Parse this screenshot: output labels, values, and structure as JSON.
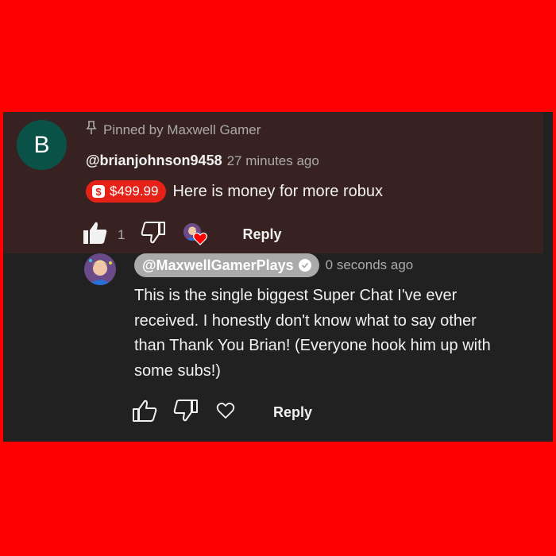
{
  "pinned_comment": {
    "avatar_letter": "B",
    "pinned_label": "Pinned by Maxwell Gamer",
    "author": "@brianjohnson9458",
    "time": "27 minutes ago",
    "superchat_amount": "$499.99",
    "text": "Here is money for more robux",
    "like_count": "1",
    "reply_label": "Reply",
    "heart_badge": "creator-heart"
  },
  "reply": {
    "author": "@MaxwellGamerPlays",
    "time": "0 seconds ago",
    "text": "This is the single biggest Super Chat I've ever received.  I honestly don't know what to say other than Thank You Brian!  (Everyone hook him up with some subs!)",
    "reply_label": "Reply"
  },
  "colors": {
    "background": "#ff0000",
    "panel": "#212121",
    "pinned_highlight": "#372221",
    "superchat": "#e62117",
    "avatar_b": "#0a5247"
  }
}
